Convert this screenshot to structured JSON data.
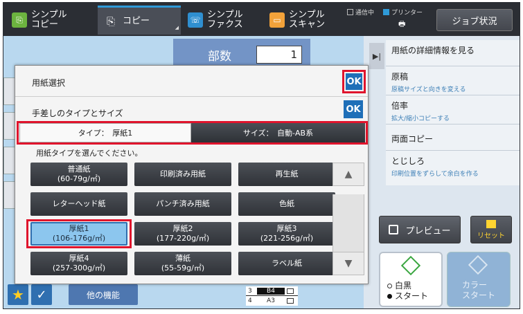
{
  "topbar": {
    "tabs": [
      {
        "label": "シンプル\nコピー",
        "line1": "シンプル",
        "line2": "コピー"
      },
      {
        "label": "コピー"
      },
      {
        "line1": "シンプル",
        "line2": "ファクス"
      },
      {
        "line1": "シンプル",
        "line2": "スキャン"
      }
    ],
    "status_receiving": "通信中",
    "status_printer": "プリンター",
    "job_status": "ジョブ状況"
  },
  "copies": {
    "label": "部数",
    "value": "1"
  },
  "right_panel": {
    "items": [
      {
        "title": "用紙の詳細情報を見る",
        "sub": ""
      },
      {
        "title": "原稿",
        "sub": "原稿サイズと向きを変える"
      },
      {
        "title": "倍率",
        "sub": "拡大/縮小コピーする"
      },
      {
        "title": "両面コピー",
        "sub": ""
      },
      {
        "title": "とじしろ",
        "sub": "印刷位置をずらして余白を作る"
      }
    ],
    "preview": "プレビュー",
    "reset": "リセット",
    "bw_start_line1": "白黒",
    "bw_start_line2": "スタート",
    "color_start_line1": "カラー",
    "color_start_line2": "スタート"
  },
  "dialog": {
    "title": "用紙選択",
    "ok": "OK",
    "subtitle": "手差しのタイプとサイズ",
    "tab_type": "タイプ：　厚紙1",
    "tab_size": "サイズ：　自動-AB系",
    "prompt": "用紙タイプを選んでください。",
    "paper_types": [
      {
        "name": "普通紙",
        "weight": "(60-79g/㎡)"
      },
      {
        "name": "印刷済み用紙",
        "weight": ""
      },
      {
        "name": "再生紙",
        "weight": ""
      },
      {
        "name": "レターヘッド紙",
        "weight": ""
      },
      {
        "name": "パンチ済み用紙",
        "weight": ""
      },
      {
        "name": "色紙",
        "weight": ""
      },
      {
        "name": "厚紙1",
        "weight": "(106-176g/㎡)"
      },
      {
        "name": "厚紙2",
        "weight": "(177-220g/㎡)"
      },
      {
        "name": "厚紙3",
        "weight": "(221-256g/㎡)"
      },
      {
        "name": "厚紙4",
        "weight": "(257-300g/㎡)"
      },
      {
        "name": "薄紙",
        "weight": "(55-59g/㎡)"
      },
      {
        "name": "ラベル紙",
        "weight": ""
      }
    ],
    "selected_index": 6
  },
  "bottom": {
    "other_functions": "他の機能",
    "tray_rows": [
      {
        "num": "3",
        "size": "B4"
      },
      {
        "num": "4",
        "size": "A3"
      }
    ]
  },
  "colors": {
    "accent_red": "#e0142c",
    "ok_blue": "#1f6fb8",
    "selected_blue": "#8cc6ee"
  }
}
